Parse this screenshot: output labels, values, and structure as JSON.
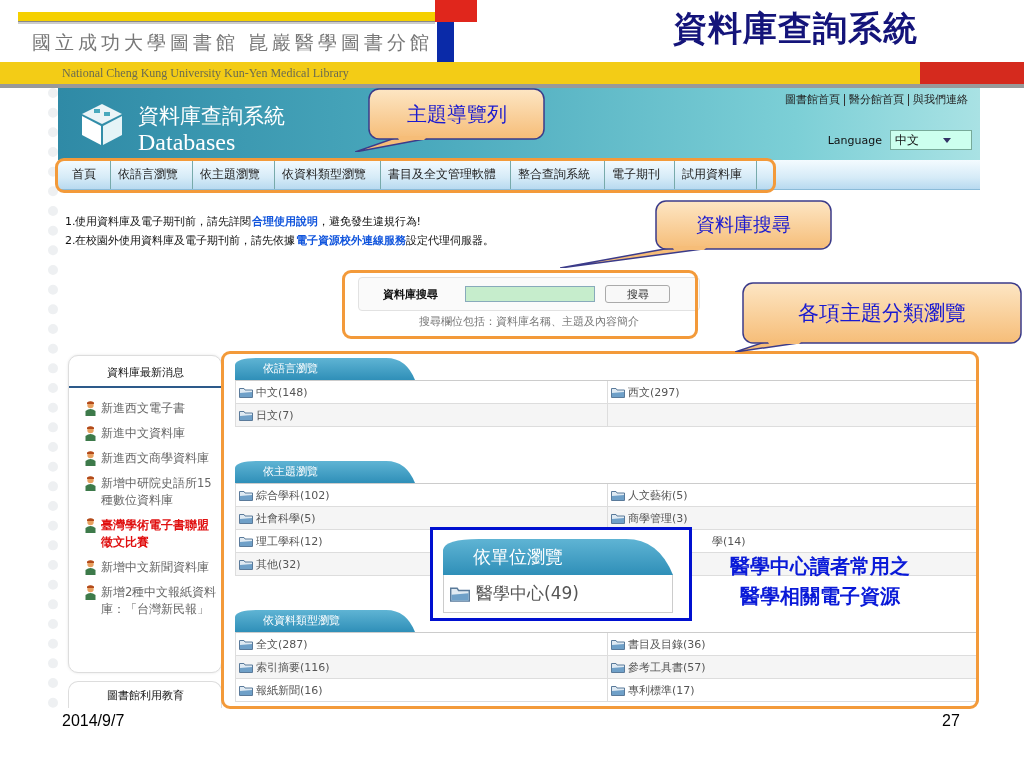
{
  "slide": {
    "logo_text": "國立成功大學圖書館 崑巖醫學圖書分館",
    "banner_text": "National Cheng Kung University Kun-Yen Medical Library",
    "title": "資料庫查詢系統",
    "date": "2014/9/7",
    "page_number": "27"
  },
  "site": {
    "title_zh": "資料庫查詢系統",
    "title_en": "Databases",
    "top_links": [
      "圖書館首頁",
      "醫分館首頁",
      "與我們連絡"
    ],
    "language_label": "Language",
    "language_value": "中文"
  },
  "nav": [
    {
      "label": "首頁"
    },
    {
      "label": "依語言瀏覽"
    },
    {
      "label": "依主題瀏覽"
    },
    {
      "label": "依資料類型瀏覽"
    },
    {
      "label": "書目及全文管理軟體"
    },
    {
      "label": "整合查詢系統"
    },
    {
      "label": "電子期刊"
    },
    {
      "label": "試用資料庫"
    }
  ],
  "notices": [
    "1.使用資料庫及電子期刊前，請先詳閱**合理使用說明**，避免發生違規行為!",
    "2.在校園外使用資料庫及電子期刊前，請先依據**電子資源校外連線服務**設定代理伺服器。"
  ],
  "search": {
    "label": "資料庫搜尋",
    "button": "搜尋",
    "hint": "搜尋欄位包括：資料庫名稱、主題及內容簡介"
  },
  "news": {
    "title": "資料庫最新消息",
    "items": [
      {
        "text": "新進西文電子書",
        "highlighted": false
      },
      {
        "text": "新進中文資料庫",
        "highlighted": false
      },
      {
        "text": "新進西文商學資料庫",
        "highlighted": false
      },
      {
        "text": "新增中研院史語所15種數位資料庫",
        "highlighted": false
      },
      {
        "text": "臺灣學術電子書聯盟徵文比賽",
        "highlighted": true
      },
      {
        "text": "新增中文新聞資料庫",
        "highlighted": false
      },
      {
        "text": "新增2種中文報紙資料庫：「台灣新民報」",
        "highlighted": false
      }
    ],
    "next_title": "圖書館利用教育"
  },
  "browse_sections": [
    {
      "title": "依語言瀏覽",
      "rows": [
        {
          "cells": [
            "中文(148)",
            "西文(297)"
          ]
        },
        {
          "cells": [
            "日文(7)"
          ]
        }
      ]
    },
    {
      "title": "依主題瀏覽",
      "rows": [
        {
          "cells": [
            "綜合學科(102)",
            "人文藝術(5)"
          ]
        },
        {
          "cells": [
            "社會科學(5)",
            "商學管理(3)"
          ]
        },
        {
          "cells": [
            "理工學科(12)",
            "學(14)"
          ],
          "right_partly_covered": true
        },
        {
          "cells": [
            "其他(32)"
          ]
        }
      ]
    },
    {
      "title": "依資料類型瀏覽",
      "rows": [
        {
          "cells": [
            "全文(287)",
            "書目及目錄(36)"
          ]
        },
        {
          "cells": [
            "索引摘要(116)",
            "參考工具書(57)"
          ]
        },
        {
          "cells": [
            "報紙新聞(16)",
            "專利標準(17)"
          ]
        }
      ]
    }
  ],
  "callouts": [
    {
      "text": "主題導覽列"
    },
    {
      "text": "資料庫搜尋"
    },
    {
      "text": "各項主題分類瀏覽"
    }
  ],
  "inset": {
    "title": "依單位瀏覽",
    "item": "醫學中心(49)"
  },
  "annotation": [
    "醫學中心讀者常用之",
    "醫學相關電子資源"
  ]
}
